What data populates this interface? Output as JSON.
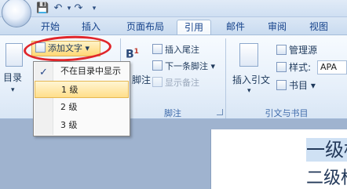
{
  "quick_access": [
    "save-icon",
    "undo-icon",
    "redo-icon",
    "customize-icon"
  ],
  "tabs": [
    {
      "label": "开始"
    },
    {
      "label": "插入"
    },
    {
      "label": "页面布局"
    },
    {
      "label": "引用"
    },
    {
      "label": "邮件"
    },
    {
      "label": "审阅"
    },
    {
      "label": "视图"
    }
  ],
  "active_tab": "引用",
  "ribbon": {
    "toc_group": {
      "toc_button": "目录",
      "add_text": "添加文字 ▾"
    },
    "footnote_group": {
      "label": "脚注",
      "footnote_fragment": "脚注",
      "insert_endnote": "插入尾注",
      "next_footnote": "下一条脚注 ▾",
      "show_notes": "显示备注"
    },
    "citation_group": {
      "label": "引文与书目",
      "insert_citation": "插入引文",
      "manage_sources": "管理源",
      "style_label": "样式:",
      "style_value": "APA",
      "bibliography": "书目 ▾"
    }
  },
  "menu": {
    "items": [
      {
        "label": "不在目录中显示",
        "checked": true
      },
      {
        "label": "1 级",
        "highlighted": true
      },
      {
        "label": "2 级"
      },
      {
        "label": "3 级"
      }
    ]
  },
  "document": {
    "heading1": "一级标",
    "heading2": "二级标"
  },
  "colors": {
    "accent": "#15428b",
    "highlight": "#ffde8a",
    "annotation": "#e0262b"
  }
}
